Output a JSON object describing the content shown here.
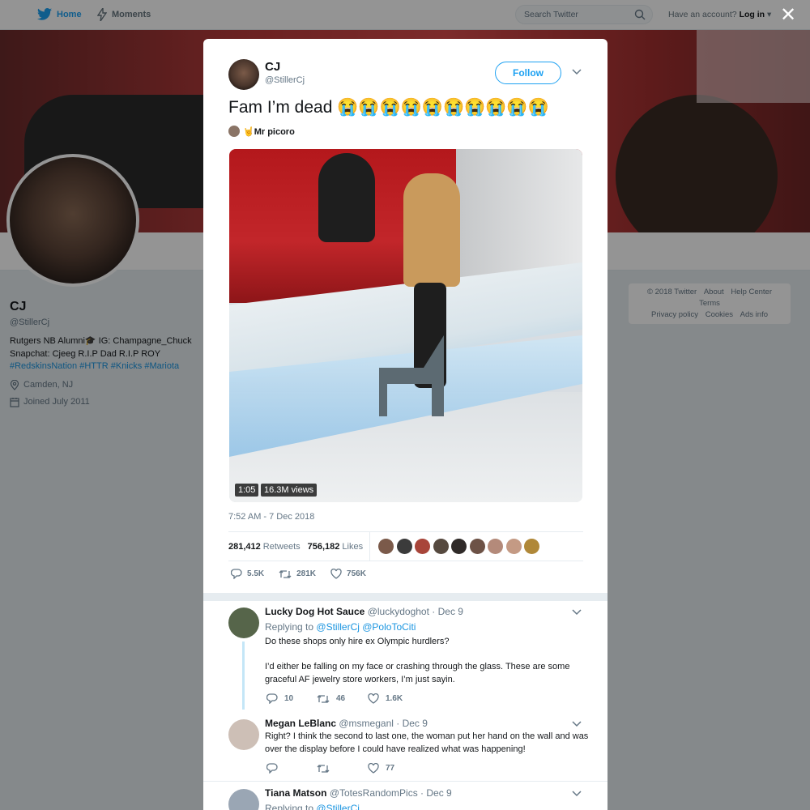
{
  "topnav": {
    "home_label": "Home",
    "moments_label": "Moments",
    "search_placeholder": "Search Twitter",
    "have_account": "Have an account?",
    "login_label": "Log in"
  },
  "profile": {
    "name": "CJ",
    "handle": "@StillerCj",
    "bio_text": "Rutgers NB Alumni🎓 IG: Champagne_Chuck Snapchat: Cjeeg R.I.P Dad R.I.P ROY",
    "bio_tags": [
      "#RedskinsNation",
      "#HTTR",
      "#Knicks",
      "#Mariota"
    ],
    "location": "Camden, NJ",
    "joined": "Joined July 2011"
  },
  "footer_links": [
    "© 2018 Twitter",
    "About",
    "Help Center",
    "Terms",
    "Privacy policy",
    "Cookies",
    "Ads info"
  ],
  "tweet": {
    "author_name": "CJ",
    "author_handle": "@StillerCj",
    "follow_label": "Follow",
    "text": "Fam I’m dead 😭😭😭😭😭😭😭😭😭😭",
    "via_label": "🤘Mr picoro",
    "video_duration": "1:05",
    "video_views": "16.3M views",
    "timestamp": "7:52 AM - 7 Dec 2018",
    "retweets_count": "281,412",
    "retweets_label": "Retweets",
    "likes_count": "756,182",
    "likes_label": "Likes",
    "reply_action": "5.5K",
    "retweet_action": "281K",
    "like_action": "756K"
  },
  "likers_colors": [
    "#7b5a4a",
    "#3b3b3b",
    "#a8453a",
    "#56493f",
    "#2f2a28",
    "#6d5246",
    "#b48a7a",
    "#c49a84",
    "#b08838"
  ],
  "replies": [
    {
      "name": "Lucky Dog Hot Sauce",
      "handle": "@luckydoghot",
      "date": "· Dec 9",
      "replying_to": "Replying to",
      "mentions": "@StillerCj @PoloToCiti",
      "text1": "Do these shops only hire ex Olympic hurdlers?",
      "text2": "I’d either be falling on my face or crashing through the glass. These are some graceful AF jewelry store workers, I’m just sayin.",
      "replies": "10",
      "retweets": "46",
      "likes": "1.6K",
      "avatar_color": "#56654a"
    },
    {
      "name": "Megan LeBlanc",
      "handle": "@msmeganl",
      "date": "· Dec 9",
      "text1": "Right? I think the second to last one, the woman put her hand on the wall and was over the display before I could have realized what was happening!",
      "replies": "",
      "retweets": "",
      "likes": "77",
      "avatar_color": "#cdbfb6"
    },
    {
      "name": "Tiana Matson",
      "handle": "@TotesRandomPics",
      "date": "· Dec 9",
      "replying_to": "Replying to",
      "mentions": "@StillerCj",
      "avatar_color": "#9aa6b4"
    }
  ],
  "colors": {
    "accent": "#1da1f2",
    "link": "#1b95e0",
    "muted": "#657786",
    "overlay": "rgba(0,0,0,0.42)"
  }
}
